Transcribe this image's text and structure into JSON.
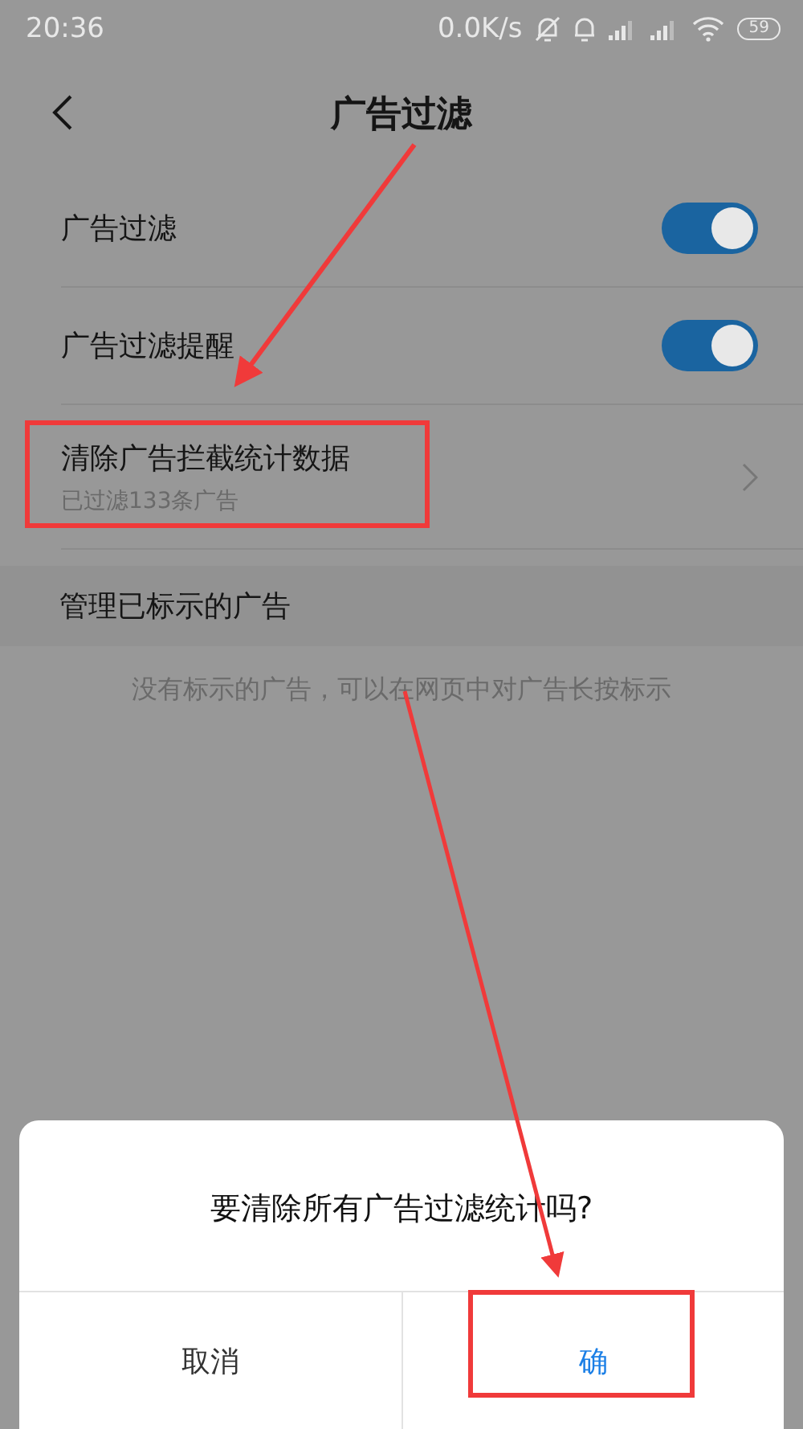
{
  "status_bar": {
    "time": "20:36",
    "net_speed": "0.0K/s",
    "battery": "59"
  },
  "header": {
    "title": "广告过滤"
  },
  "settings": [
    {
      "kind": "toggle",
      "label": "广告过滤",
      "on": true
    },
    {
      "kind": "toggle",
      "label": "广告过滤提醒",
      "on": true
    },
    {
      "kind": "link",
      "label": "清除广告拦截统计数据",
      "subtitle": "已过滤133条广告"
    }
  ],
  "section": {
    "title": "管理已标示的广告",
    "empty_text": "没有标示的广告，可以在网页中对广告长按标示"
  },
  "dialog": {
    "message": "要清除所有广告过滤统计吗?",
    "buttons": [
      {
        "kind": "cancel",
        "label": "取消"
      },
      {
        "kind": "confirm",
        "label": "确"
      }
    ]
  }
}
